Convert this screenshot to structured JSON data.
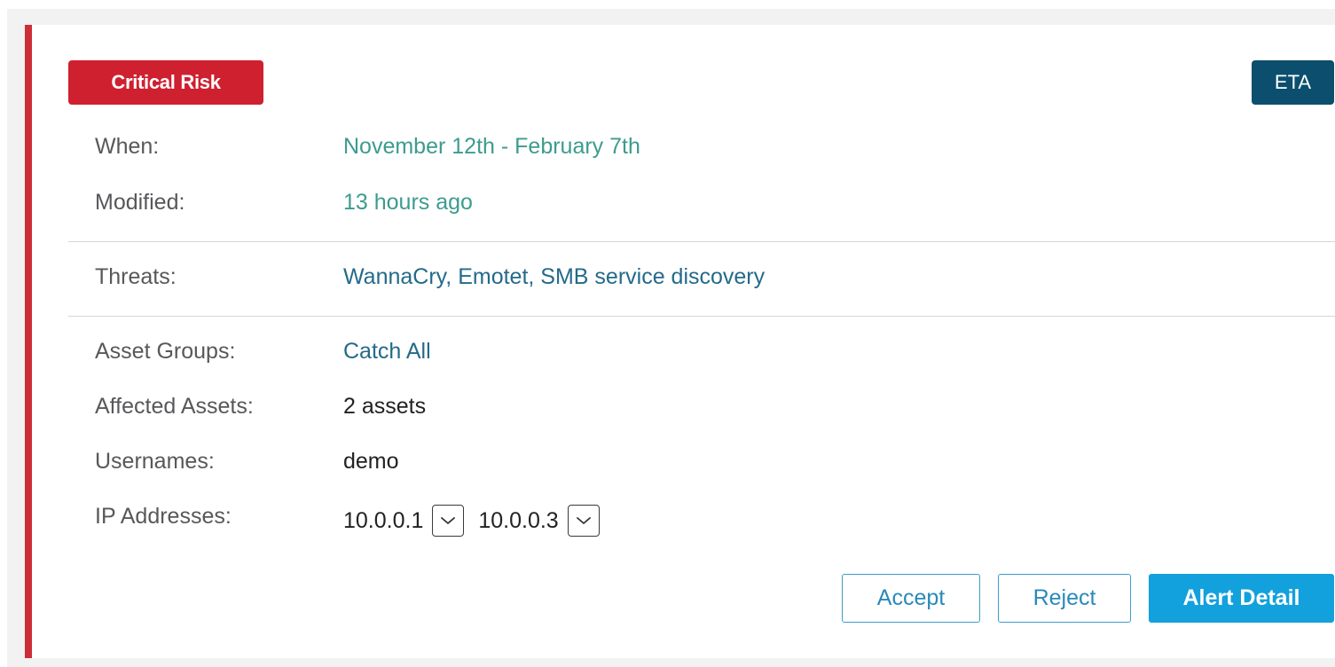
{
  "alert": {
    "severity_label": "Critical Risk",
    "source_badge": "ETA",
    "colors": {
      "critical": "#cf2030",
      "eta_badge": "#0b4e6e",
      "teal_value": "#3d9b8f",
      "link_value": "#246a8a",
      "primary_button": "#12a1dc"
    },
    "fields": {
      "when": {
        "label": "When:",
        "value": "November 12th - February 7th"
      },
      "modified": {
        "label": "Modified:",
        "value": "13 hours ago"
      },
      "threats": {
        "label": "Threats:",
        "value": "WannaCry, Emotet, SMB service discovery"
      },
      "asset_groups": {
        "label": "Asset Groups:",
        "value": "Catch All"
      },
      "affected_assets": {
        "label": "Affected Assets:",
        "value": "2 assets"
      },
      "usernames": {
        "label": "Usernames:",
        "value": "demo"
      },
      "ip_addresses": {
        "label": "IP Addresses:",
        "items": [
          "10.0.0.1",
          "10.0.0.3"
        ],
        "expand_icon": "chevron-down-icon"
      }
    },
    "actions": {
      "accept": "Accept",
      "reject": "Reject",
      "detail": "Alert Detail"
    }
  }
}
